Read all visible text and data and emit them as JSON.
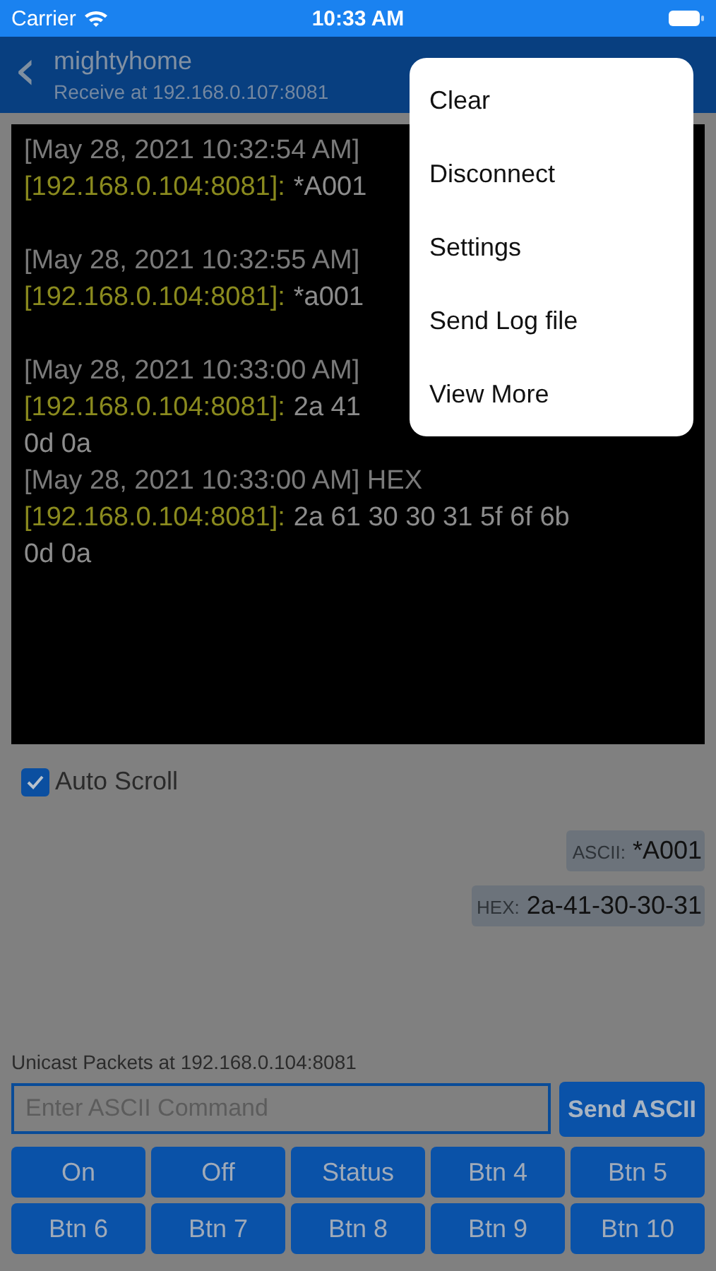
{
  "status_bar": {
    "carrier": "Carrier",
    "time": "10:33 AM"
  },
  "nav": {
    "back": "‹",
    "title": "mightyhome",
    "subtitle": "Receive at 192.168.0.107:8081"
  },
  "log": [
    {
      "header": "[May 28, 2021 10:32:54 AM]",
      "source": "[192.168.0.104:8081]:",
      "lines": [
        "*A001"
      ],
      "separated": false
    },
    {
      "header": "[May 28, 2021 10:32:55 AM]",
      "source": "[192.168.0.104:8081]:",
      "lines": [
        "*a001"
      ],
      "separated": true
    },
    {
      "header": "[May 28, 2021 10:33:00 AM]",
      "source": "[192.168.0.104:8081]:",
      "lines": [
        "2a 41",
        "0d 0a"
      ],
      "separated": true
    },
    {
      "header": "[May 28, 2021 10:33:00 AM] HEX",
      "source": "[192.168.0.104:8081]:",
      "lines": [
        "2a 61 30 30 31 5f 6f 6b",
        "0d 0a"
      ],
      "separated": false
    }
  ],
  "auto_scroll": {
    "label": "Auto Scroll",
    "checked": true
  },
  "last_received": [
    {
      "label": "ASCII:",
      "value": "*A001"
    },
    {
      "label": "HEX:",
      "value": "2a-41-30-30-31"
    }
  ],
  "send": {
    "caption": "Unicast Packets at 192.168.0.104:8081",
    "placeholder": "Enter ASCII Command",
    "button": "Send ASCII"
  },
  "buttons": [
    "On",
    "Off",
    "Status",
    "Btn 4",
    "Btn 5",
    "Btn 6",
    "Btn 7",
    "Btn 8",
    "Btn 9",
    "Btn 10"
  ],
  "menu": [
    "Clear",
    "Disconnect",
    "Settings",
    "Send Log file",
    "View More"
  ]
}
